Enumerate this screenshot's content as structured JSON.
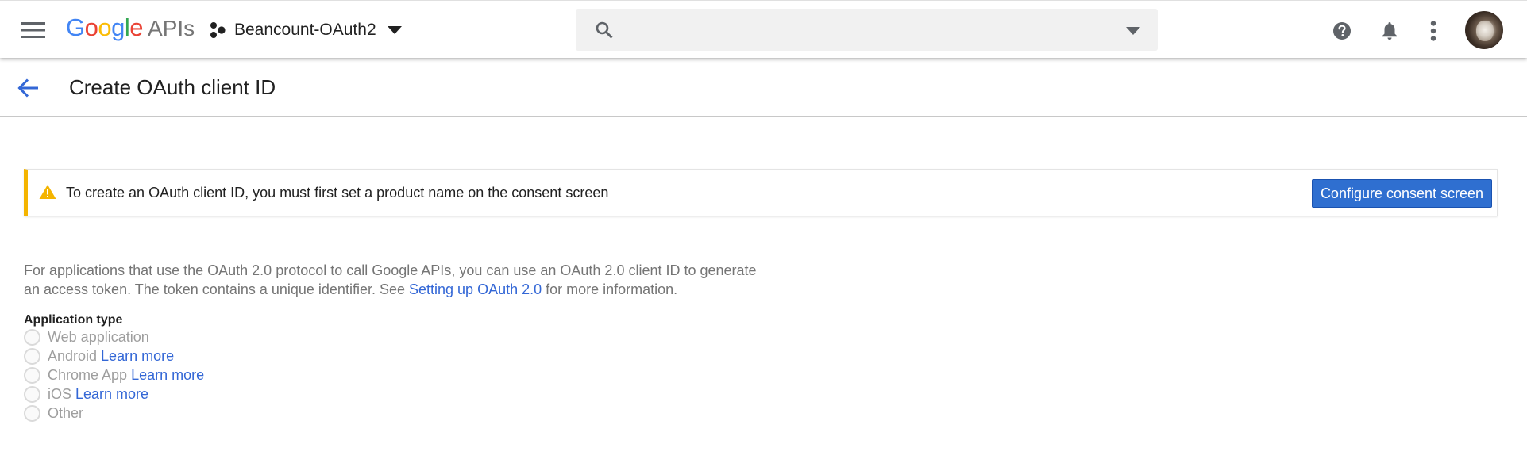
{
  "header": {
    "logo_brand_letters": [
      {
        "ch": "G",
        "color": "#4285F4"
      },
      {
        "ch": "o",
        "color": "#EA4335"
      },
      {
        "ch": "o",
        "color": "#FBBC05"
      },
      {
        "ch": "g",
        "color": "#4285F4"
      },
      {
        "ch": "l",
        "color": "#34A853"
      },
      {
        "ch": "e",
        "color": "#EA4335"
      }
    ],
    "logo_brand": "Google",
    "logo_suffix": "APIs",
    "project_name": "Beancount-OAuth2",
    "search_value": "",
    "icons": [
      "menu-icon",
      "project-icon",
      "search-icon",
      "help-icon",
      "notifications-icon",
      "more-vert-icon"
    ]
  },
  "page": {
    "title": "Create OAuth client ID"
  },
  "alert": {
    "message": "To create an OAuth client ID, you must first set a product name on the consent screen",
    "button_label": "Configure consent screen",
    "accent_color": "#F4B400"
  },
  "description": {
    "text_before_link": "For applications that use the OAuth 2.0 protocol to call Google APIs, you can use an OAuth 2.0 client ID to generate an access token. The token contains a unique identifier. See ",
    "link_text": "Setting up OAuth 2.0",
    "text_after_link": " for more information."
  },
  "application_type": {
    "label": "Application type",
    "options": [
      {
        "label": "Web application",
        "link": ""
      },
      {
        "label": "Android",
        "link": "Learn more"
      },
      {
        "label": "Chrome App",
        "link": "Learn more"
      },
      {
        "label": "iOS",
        "link": "Learn more"
      },
      {
        "label": "Other",
        "link": ""
      }
    ]
  },
  "colors": {
    "link": "#3367D6",
    "primary_button": "#2F6FD0",
    "disabled_text": "#9E9E9E"
  }
}
